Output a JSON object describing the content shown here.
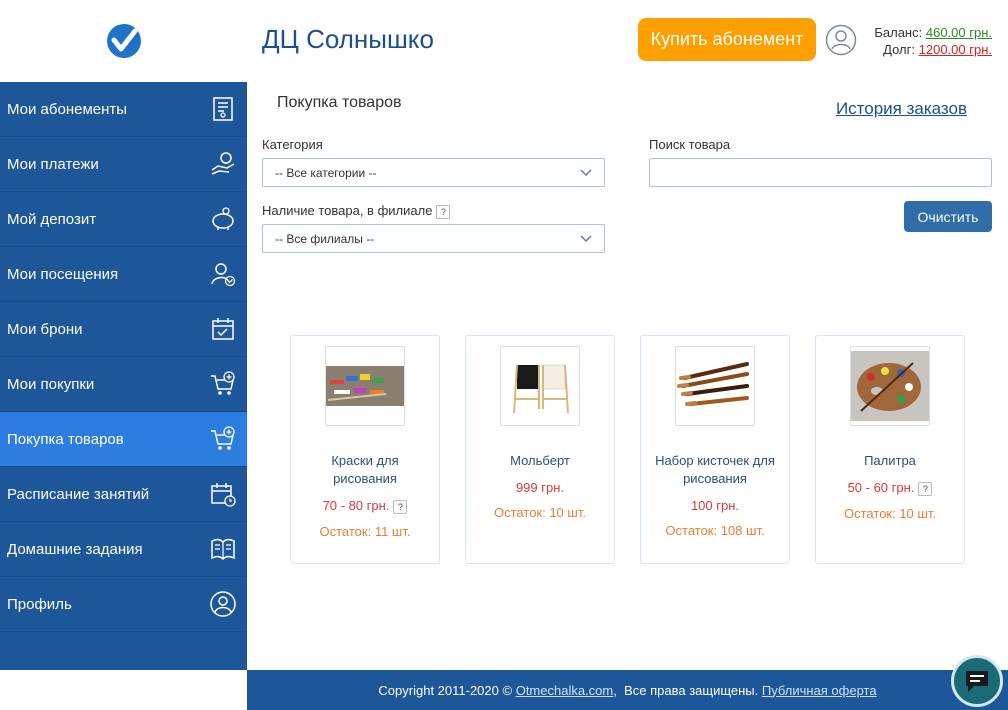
{
  "header": {
    "site_title": "ДЦ Солнышко",
    "buy_button": "Купить абонемент",
    "balance_label": "Баланс:",
    "balance_value": "460.00 грн.",
    "debt_label": "Долг:",
    "debt_value": "1200.00 грн."
  },
  "sidebar": {
    "items": [
      {
        "label": "Мои абонементы",
        "icon": "receipt-icon"
      },
      {
        "label": "Мои платежи",
        "icon": "payment-hand-icon"
      },
      {
        "label": "Мой депозит",
        "icon": "piggy-bank-icon"
      },
      {
        "label": "Мои посещения",
        "icon": "user-check-icon"
      },
      {
        "label": "Мои брони",
        "icon": "calendar-check-icon"
      },
      {
        "label": "Мои покупки",
        "icon": "cart-plus-icon"
      },
      {
        "label": "Покупка товаров",
        "icon": "cart-plus-icon"
      },
      {
        "label": "Расписание занятий",
        "icon": "calendar-clock-icon"
      },
      {
        "label": "Домашние задания",
        "icon": "book-icon"
      },
      {
        "label": "Профиль",
        "icon": "profile-icon"
      }
    ],
    "active_index": 6
  },
  "main": {
    "heading": "Покупка товаров",
    "history_link": "История заказов",
    "category_label": "Категория",
    "category_value": "-- Все категории --",
    "search_label": "Поиск товара",
    "search_placeholder": "",
    "availability_label": "Наличие товара, в филиале",
    "availability_value": "-- Все филиалы --",
    "help_badge": "?",
    "clear_button": "Очистить"
  },
  "products": [
    {
      "name": "Краски для рисования",
      "price": "70 - 80 грн.",
      "has_help": true,
      "stock": "Остаток: 11 шт."
    },
    {
      "name": "Мольберт",
      "price": "999 грн.",
      "has_help": false,
      "stock": "Остаток: 10 шт."
    },
    {
      "name": "Набор кисточек для рисования",
      "price": "100 грн.",
      "has_help": false,
      "stock": "Остаток: 108 шт."
    },
    {
      "name": "Палитра",
      "price": "50 - 60 грн.",
      "has_help": true,
      "stock": "Остаток: 10 шт."
    }
  ],
  "footer": {
    "copyright": "Copyright 2011-2020 ©",
    "site_link": "Otmechalka.com",
    "rights": ",  Все права защищены.",
    "offer_link": "Публичная оферта"
  },
  "colors": {
    "sidebar": "#1e5799",
    "sidebar_active": "#2d7de0",
    "accent_orange": "#ff9f00",
    "title_blue": "#1f4e8c"
  }
}
